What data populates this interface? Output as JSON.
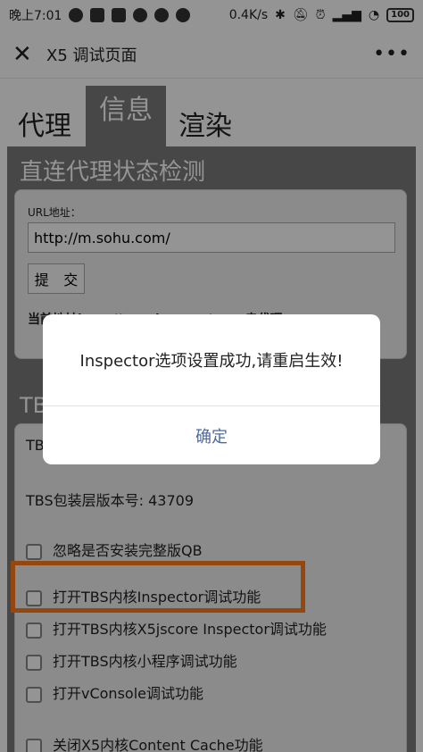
{
  "status": {
    "time": "晚上7:01",
    "speed": "0.4K/s",
    "battery": "100"
  },
  "header": {
    "title": "X5 调试页面",
    "more": "•••"
  },
  "tabs": [
    {
      "label": "代理"
    },
    {
      "label": "信息"
    },
    {
      "label": "渲染"
    }
  ],
  "proxy": {
    "title": "直连代理状态检测",
    "url_label": "URL地址：",
    "url_value": "http://m.sohu.com/",
    "submit_label": "提 交",
    "current_addr": "当前地址http://m.sohu.com/ …… 走代理"
  },
  "tbs": {
    "title": "TBS",
    "core_version": "TBS",
    "shell_version": "TBS包装层版本号: 43709",
    "options": [
      {
        "label": "忽略是否安装完整版QB"
      },
      {
        "label": "打开TBS内核Inspector调试功能"
      },
      {
        "label": "打开TBS内核X5jscore Inspector调试功能"
      },
      {
        "label": "打开TBS内核小程序调试功能"
      },
      {
        "label": "打开vConsole调试功能"
      },
      {
        "label": "关闭X5内核Content Cache功能"
      }
    ]
  },
  "dialog": {
    "message": "Inspector选项设置成功,请重启生效!",
    "ok_label": "确定"
  },
  "colors": {
    "highlight": "#ff7a1a",
    "dialog_button": "#4a6aa0",
    "panel_bg": "#7a7a7a"
  }
}
